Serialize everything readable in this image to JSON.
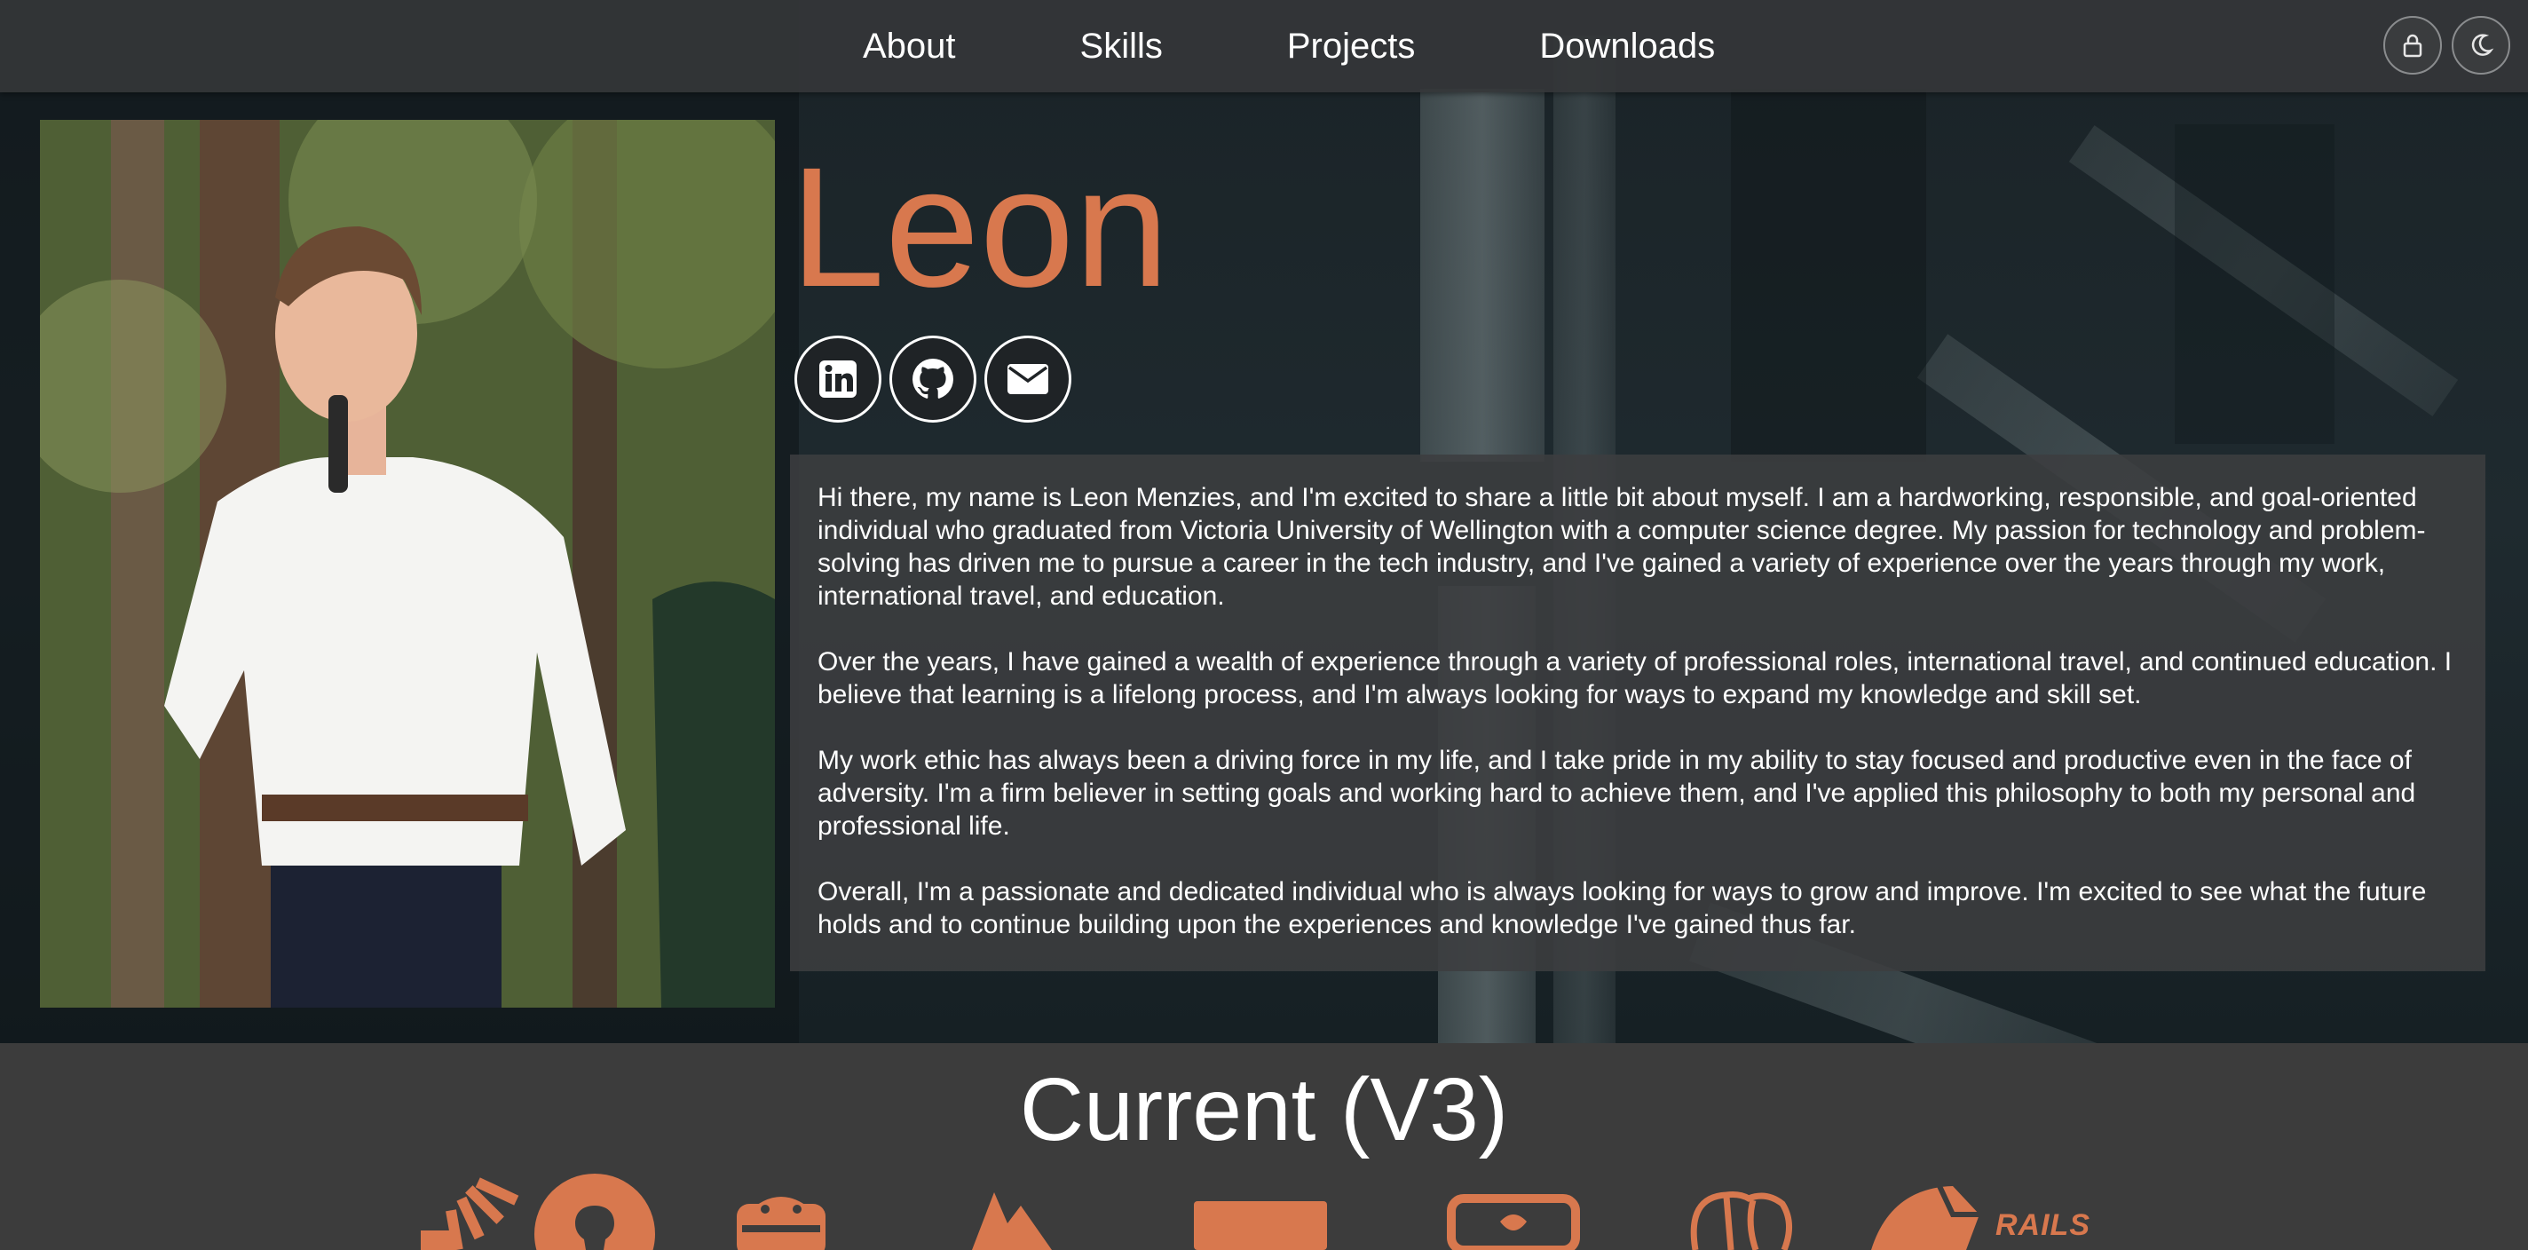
{
  "nav": {
    "links": [
      "About",
      "Skills",
      "Projects",
      "Downloads"
    ],
    "lock_icon": "lock-icon",
    "theme_icon": "moon-icon"
  },
  "profile": {
    "name": "Leon",
    "photo_icon": "profile-photo",
    "socials": [
      {
        "icon": "linkedin-icon"
      },
      {
        "icon": "github-icon"
      },
      {
        "icon": "email-icon"
      }
    ],
    "about": [
      "Hi there, my name is Leon Menzies, and I'm excited to share a little bit about myself. I am a hardworking, responsible, and goal-oriented individual who graduated from Victoria University of Wellington with a computer science degree. My passion for technology and problem-solving has driven me to pursue a career in the tech industry, and I've gained a variety of experience over the years through my work, international travel, and education.",
      "Over the years, I have gained a wealth of experience through a variety of professional roles, international travel, and continued education. I believe that learning is a lifelong process, and I'm always looking for ways to expand my knowledge and skill set.",
      "My work ethic has always been a driving force in my life, and I take pride in my ability to stay focused and productive even in the face of adversity. I'm a firm believer in setting goals and working hard to achieve them, and I've applied this philosophy to both my personal and professional life.",
      "Overall, I'm a passionate and dedicated individual who is always looking for ways to grow and improve. I'm excited to see what the future holds and to continue building upon the experiences and knowledge I've gained thus far."
    ]
  },
  "current": {
    "title": "Current (V3)",
    "tech_icons": [
      "stackoverflow-icon",
      "github-icon",
      "android-icon",
      "firebase-icon",
      "card-icon",
      "devto-icon",
      "postgresql-icon",
      "rails-icon"
    ],
    "rails_label": "RAILS"
  },
  "colors": {
    "accent": "#d8784e",
    "nav_bg": "#343638",
    "panel_bg": "#3c3e40",
    "bottom_bg": "#3c3c3c"
  }
}
